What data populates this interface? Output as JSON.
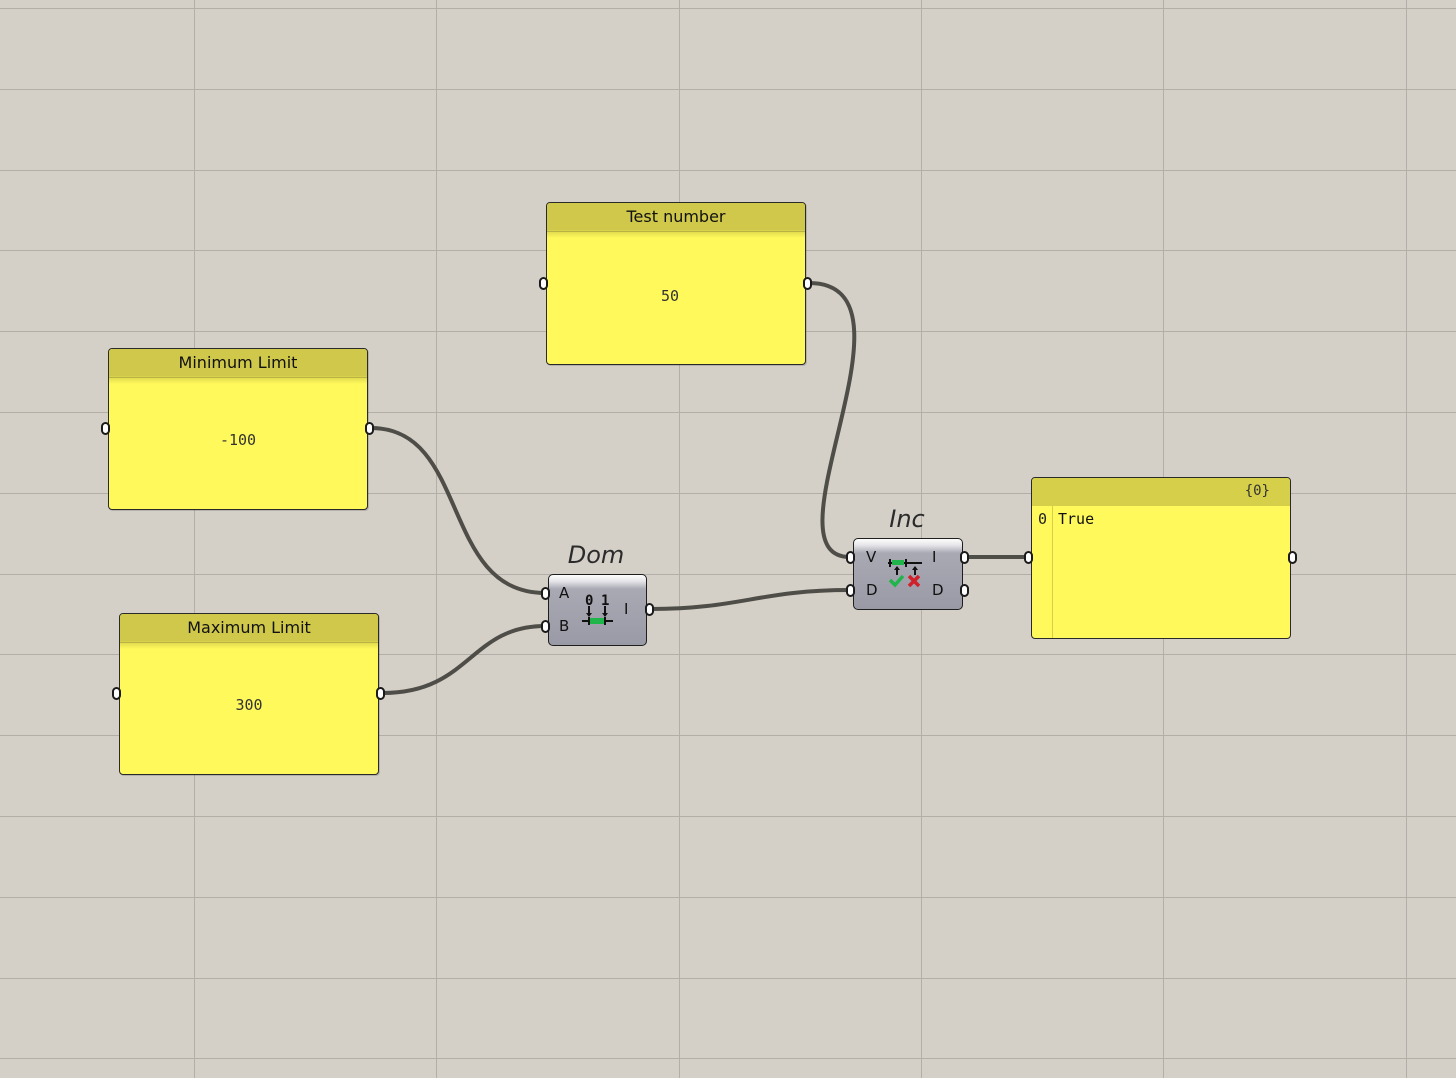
{
  "panels": {
    "minimum": {
      "title": "Minimum Limit",
      "value": "-100"
    },
    "maximum": {
      "title": "Maximum Limit",
      "value": "300"
    },
    "test": {
      "title": "Test number",
      "value": "50"
    }
  },
  "components": {
    "domain": {
      "nickname": "Dom",
      "inputs": [
        "A",
        "B"
      ],
      "outputs": [
        "I"
      ],
      "icon": "construct-domain-icon"
    },
    "includes": {
      "nickname": "Inc",
      "inputs": [
        "V",
        "D"
      ],
      "outputs": [
        "I",
        "D"
      ],
      "icon": "includes-icon"
    }
  },
  "output_panel": {
    "path": "{0}",
    "items": [
      {
        "index": "0",
        "value": "True"
      }
    ]
  },
  "colors": {
    "canvas": "#d4d0c8",
    "panel_fill": "#fff95c",
    "panel_header": "#cfc84a",
    "wire": "#4f4d47",
    "component": "#9a9aa6",
    "icon_green": "#1fb54a",
    "icon_red": "#d0202a"
  }
}
